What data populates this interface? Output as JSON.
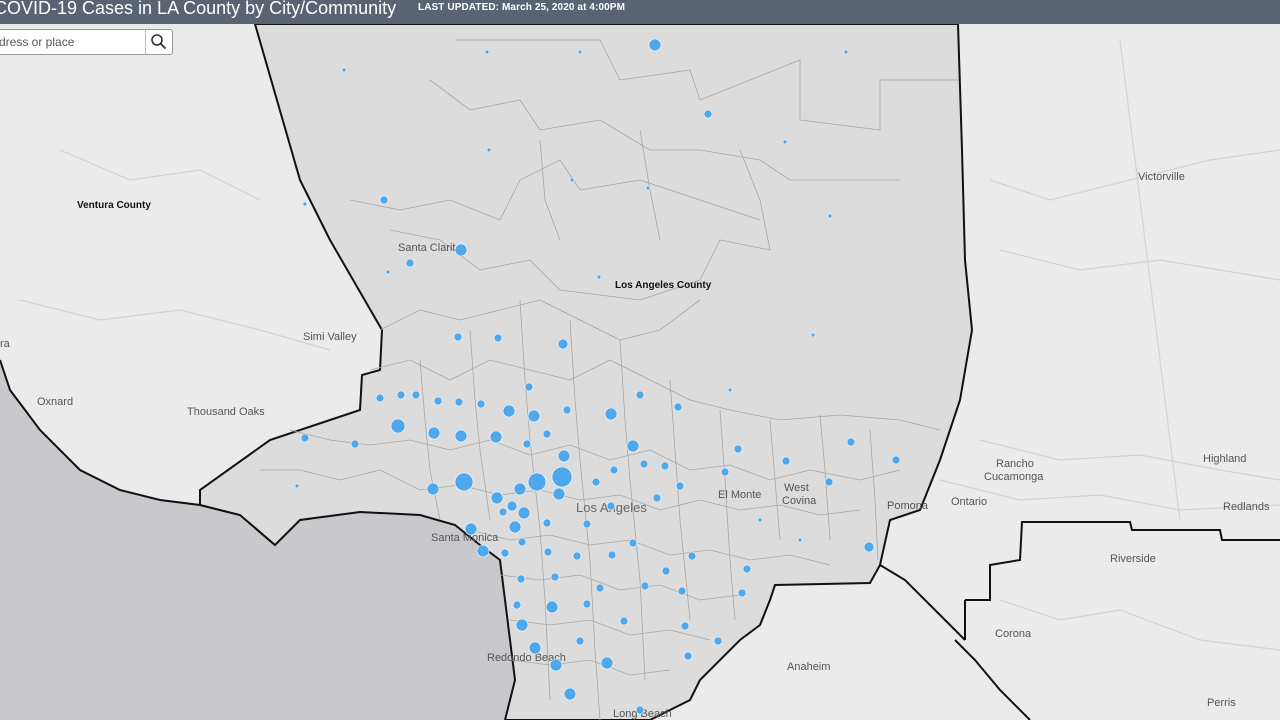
{
  "header": {
    "title": "COVID-19 Cases in LA County by City/Community",
    "last_updated": "LAST UPDATED: March 25, 2020 at 4:00PM"
  },
  "search": {
    "placeholder": "dress or place",
    "icon": "search-icon"
  },
  "region_labels": [
    "Ventura County",
    "Los Angeles County"
  ],
  "place_labels": [
    "Santa Clarita",
    "Simi Valley",
    "Oxnard",
    "Thousand Oaks",
    "Santa Monica",
    "Los Angeles",
    "El Monte",
    "West Covina",
    "Pomona",
    "Redondo Beach",
    "Long Beach",
    "Anaheim",
    "Ontario",
    "Rancho Cucamonga",
    "Highland",
    "Redlands",
    "Riverside",
    "Corona",
    "Perris",
    "Victorville",
    "ra"
  ],
  "colors": {
    "header": "#5a6371",
    "county_fill": "#dcdcdc",
    "basemap": "#ebebeb",
    "ocean": "#c9c9cd",
    "case_marker": "#4fa7ec"
  }
}
